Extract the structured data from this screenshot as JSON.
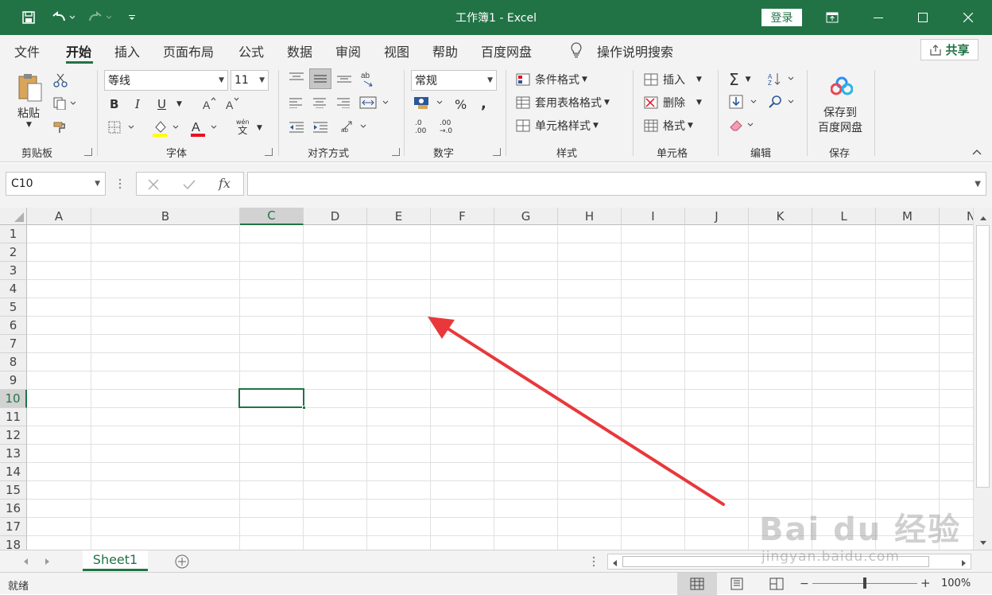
{
  "titlebar": {
    "title": "工作簿1  -  Excel",
    "login_label": "登录",
    "undo_icon": "undo-icon",
    "redo_icon": "redo-icon"
  },
  "menu": {
    "tabs": [
      "文件",
      "开始",
      "插入",
      "页面布局",
      "公式",
      "数据",
      "审阅",
      "视图",
      "帮助",
      "百度网盘"
    ],
    "active_tab": "开始",
    "tell_me": "操作说明搜索",
    "share_label": "共享"
  },
  "ribbon": {
    "clipboard": {
      "paste_label": "粘贴",
      "group_label": "剪贴板"
    },
    "font": {
      "font_name": "等线",
      "font_size": "11",
      "bold": "B",
      "italic": "I",
      "underline": "U",
      "group_label": "字体",
      "wen_label": "wén",
      "wen_char": "文"
    },
    "alignment": {
      "group_label": "对齐方式"
    },
    "number": {
      "format": "常规",
      "percent": "%",
      "comma": ",",
      "group_label": "数字",
      "inc_decimal_top": ".0",
      "inc_decimal_bottom": ".00",
      "dec_decimal_top": ".00",
      "dec_decimal_bottom": "→.0"
    },
    "styles": {
      "conditional": "条件格式",
      "table": "套用表格格式",
      "cell_styles": "单元格样式",
      "group_label": "样式"
    },
    "cells": {
      "insert": "插入",
      "delete": "删除",
      "format": "格式",
      "group_label": "单元格"
    },
    "editing": {
      "group_label": "编辑",
      "sum_symbol": "Σ"
    },
    "save": {
      "line1": "保存到",
      "line2": "百度网盘",
      "group_label": "保存"
    }
  },
  "formula_bar": {
    "name_box": "C10",
    "fx_label": "fx",
    "formula": ""
  },
  "grid": {
    "columns": [
      "A",
      "B",
      "C",
      "D",
      "E",
      "F",
      "G",
      "H",
      "I",
      "J",
      "K",
      "L",
      "M",
      "N"
    ],
    "rows": [
      "1",
      "2",
      "3",
      "4",
      "5",
      "6",
      "7",
      "8",
      "9",
      "10",
      "11",
      "12",
      "13",
      "14",
      "15",
      "16",
      "17",
      "18"
    ],
    "selected_cell": "C10"
  },
  "sheets": {
    "tabs": [
      "Sheet1"
    ]
  },
  "status": {
    "mode": "就绪",
    "zoom": "100%"
  },
  "watermark": {
    "text1": "Bai du 经验",
    "text2": "jingyan.baidu.com"
  },
  "colors": {
    "brand": "#217346",
    "arrow": "#e8383b"
  }
}
